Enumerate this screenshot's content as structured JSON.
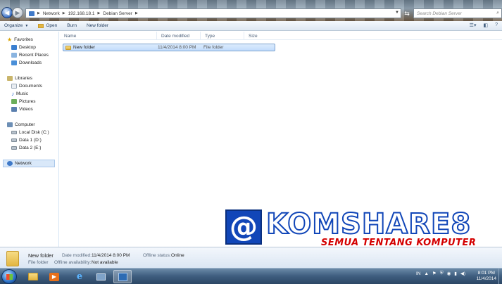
{
  "address_bar": {
    "crumbs": [
      "Network",
      "192.168.18.1",
      "Debian Server"
    ],
    "search_placeholder": "Search Debian Server"
  },
  "toolbar": {
    "organize": "Organize",
    "open": "Open",
    "burn": "Burn",
    "new_folder": "New folder"
  },
  "nav": {
    "favorites": "Favorites",
    "desktop": "Desktop",
    "recent": "Recent Places",
    "downloads": "Downloads",
    "libraries": "Libraries",
    "documents": "Documents",
    "music": "Music",
    "pictures": "Pictures",
    "videos": "Videos",
    "computer": "Computer",
    "disk_c": "Local Disk (C:)",
    "disk_d": "Data 1 (D:)",
    "disk_e": "Data 2 (E:)",
    "network": "Network"
  },
  "columns": {
    "name": "Name",
    "date": "Date modified",
    "type": "Type",
    "size": "Size"
  },
  "files": [
    {
      "name": "New folder",
      "date": "11/4/2014 8:00 PM",
      "type": "File folder"
    }
  ],
  "watermark": {
    "at": "@",
    "brand": "KOMSHARE8",
    "tagline": "SEMUA TENTANG KOMPUTER"
  },
  "details": {
    "name": "New folder",
    "kind": "File folder",
    "date_label": "Date modified:",
    "date_value": "11/4/2014 8:00 PM",
    "offline_status_label": "Offline status:",
    "offline_status_value": "Online",
    "offline_avail_label": "Offline availability:",
    "offline_avail_value": "Not available"
  },
  "taskbar": {
    "lang": "IN",
    "time": "8:01 PM",
    "date": "11/4/2014"
  }
}
